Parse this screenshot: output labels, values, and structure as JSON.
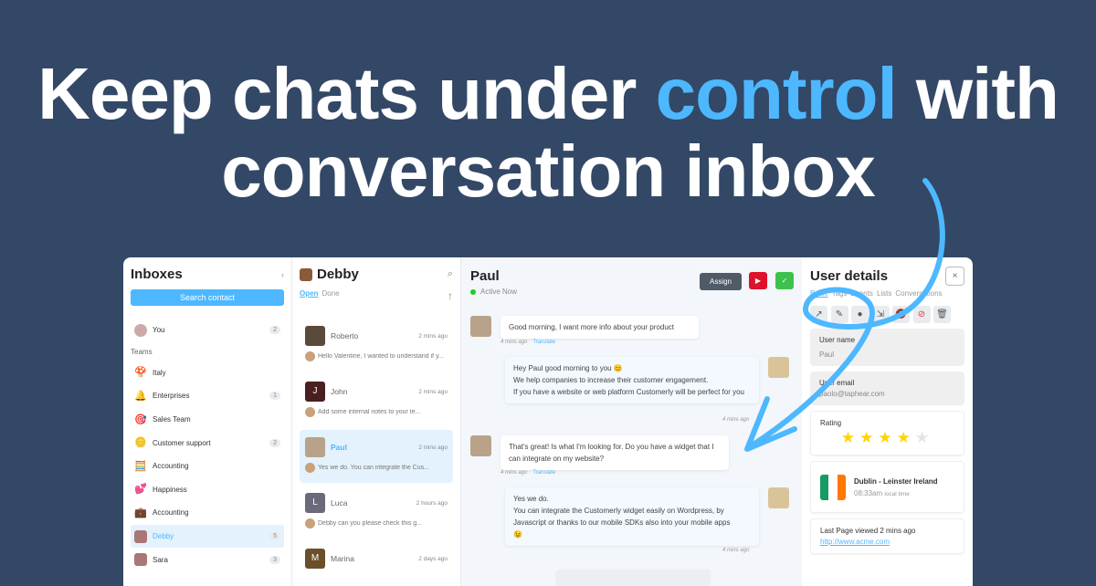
{
  "headline": {
    "line1_pre": "Keep chats under ",
    "line1_accent": "control",
    "line1_post": " with",
    "line2": "conversation inbox"
  },
  "inboxes": {
    "title": "Inboxes",
    "collapse": "‹",
    "search_label": "Search contact",
    "you": {
      "label": "You",
      "count": "2"
    },
    "teams_label": "Teams",
    "teams": [
      {
        "label": "Italy",
        "icon": "🍄",
        "count": ""
      },
      {
        "label": "Enterprises",
        "icon": "🔔",
        "count": "1"
      },
      {
        "label": "Sales Team",
        "icon": "🎯",
        "count": ""
      },
      {
        "label": "Customer support",
        "icon": "🪙",
        "count": "2"
      },
      {
        "label": "Accounting",
        "icon": "🧮",
        "count": ""
      },
      {
        "label": "Happiness",
        "icon": "💕",
        "count": ""
      },
      {
        "label": "Accounting",
        "icon": "💼",
        "count": ""
      },
      {
        "label": "Debby",
        "icon": "",
        "count": "5"
      },
      {
        "label": "Sara",
        "icon": "",
        "count": "3"
      }
    ]
  },
  "list": {
    "title": "Debby",
    "tab_open": "Open",
    "tab_done": "Done",
    "conversations": [
      {
        "name": "Roberto",
        "time": "2 mins ago",
        "preview": "Hello Valentine, I wanted to understand if y...",
        "initial": "",
        "color": "#5a4a3a"
      },
      {
        "name": "John",
        "time": "2 mins ago",
        "preview": "Add some internal notes to your te...",
        "initial": "J",
        "color": "#4a1f1f"
      },
      {
        "name": "Paul",
        "time": "2 mins ago",
        "preview": "Yes we do.  You can integrate the Cus...",
        "initial": "",
        "color": "#b8a38a"
      },
      {
        "name": "Luca",
        "time": "2 hours ago",
        "preview": "Debby can you please check this g...",
        "initial": "L",
        "color": "#6a6a7a"
      },
      {
        "name": "Marina",
        "time": "2 days ago",
        "preview": "",
        "initial": "M",
        "color": "#6b4f2a"
      }
    ]
  },
  "chat": {
    "name": "Paul",
    "status": "Active Now",
    "assign": "Assign",
    "status_color": "#22cc22",
    "messages": [
      {
        "text": "Good morning, I want more info about your product",
        "time": "4 mins ago",
        "translate": "Translate"
      },
      {
        "text": "Hey Paul good morning to you 😊\nWe help companies to increase their customer engagement.\nIf you have a website or web platform Customerly will be perfect for you",
        "time": "4 mins ago"
      },
      {
        "text": "That's great! Is what I'm looking for. Do you have a widget that I can integrate on my website?",
        "time": "4 mins ago",
        "translate": "Translate"
      },
      {
        "text": "Yes we do.\nYou can integrate the Customerly widget easily on Wordpress, by Javascript or thanks to our mobile SDKs also into your mobile apps\n😉",
        "time": "4 mins ago"
      }
    ]
  },
  "details": {
    "title": "User details",
    "close": "×",
    "tabs": [
      "Basic",
      "Tags",
      "Events",
      "Lists",
      "Conversations"
    ],
    "user_name_label": "User name",
    "user_name": "Paul",
    "email_label": "User email",
    "email": "paolo@taphear.com",
    "rating_label": "Rating",
    "rating": 4,
    "rating_max": 5,
    "location": "Dublin - Leinster Ireland",
    "local_time": "08:33am",
    "local_time_label": "local time",
    "last_page": "Last Page viewed 2 mins ago",
    "last_url": "http://www.acme.com"
  }
}
